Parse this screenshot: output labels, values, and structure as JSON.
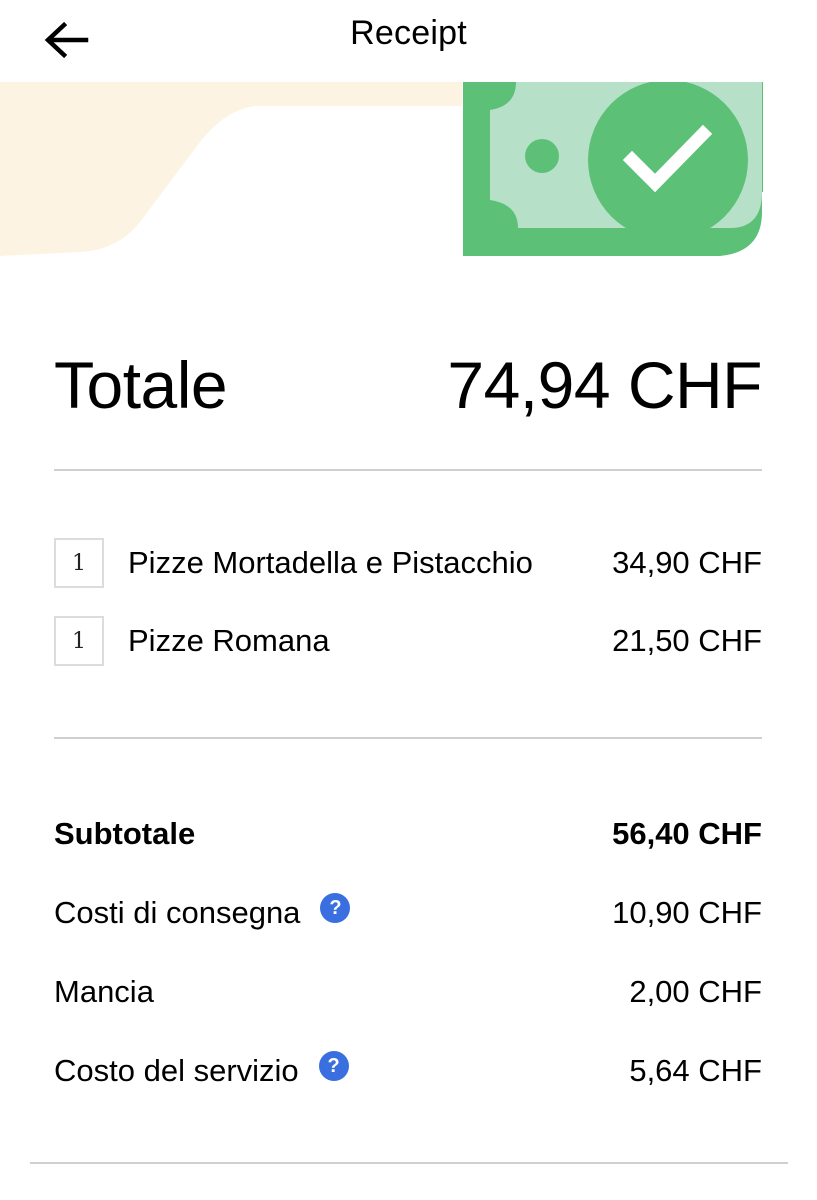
{
  "header": {
    "title": "Receipt",
    "back_icon": "arrow-left-icon"
  },
  "hero": {
    "illustration": "cash-payment-check-illustration",
    "colors": {
      "cream": "#fdf3e2",
      "bill_light": "#b7e0c9",
      "bill_dark": "#5cc177",
      "check": "#ffffff"
    }
  },
  "total": {
    "label": "Totale",
    "value": "74,94 CHF"
  },
  "items": [
    {
      "qty": "1",
      "name": "Pizze Mortadella e Pistacchio",
      "price": "34,90 CHF"
    },
    {
      "qty": "1",
      "name": "Pizze Romana",
      "price": "21,50 CHF"
    }
  ],
  "summary": {
    "subtotal": {
      "label": "Subtotale",
      "value": "56,40 CHF"
    },
    "delivery": {
      "label": "Costi di consegna",
      "value": "10,90 CHF",
      "help": "?"
    },
    "tip": {
      "label": "Mancia",
      "value": "2,00 CHF"
    },
    "service": {
      "label": "Costo del servizio",
      "value": "5,64 CHF",
      "help": "?"
    }
  },
  "colors": {
    "divider": "#d0d0d0",
    "help_icon": "#3a6fe0"
  }
}
